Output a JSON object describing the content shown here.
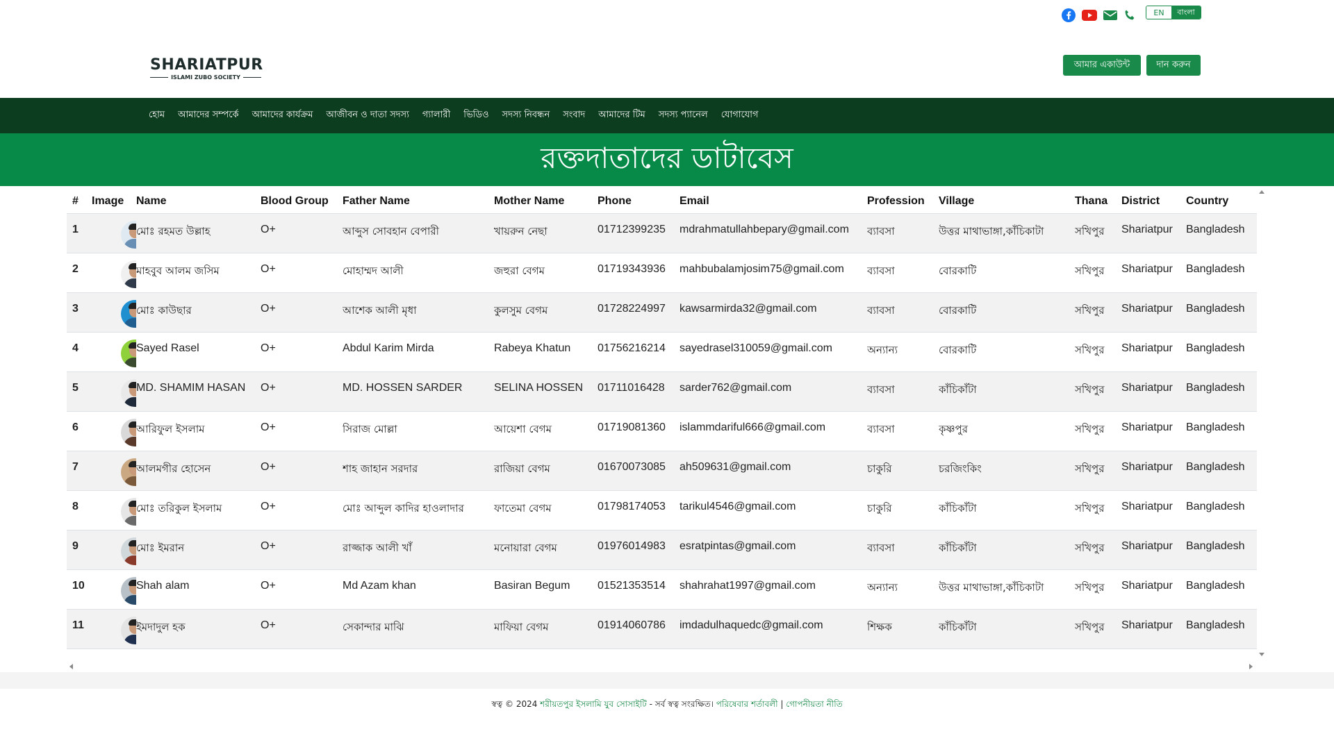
{
  "top_bar": {
    "icons": [
      "facebook-icon",
      "youtube-icon",
      "email-icon",
      "phone-icon"
    ],
    "lang_en": "EN",
    "lang_bn": "বাংলা"
  },
  "logo": {
    "main": "SHARIATPUR",
    "sub": "ISLAMI ZUBO SOCIETY"
  },
  "header": {
    "account_label": "আমার একাউন্ট",
    "donate_label": "দান করুন"
  },
  "nav": {
    "items": [
      "হোম",
      "আমাদের সম্পর্কে",
      "আমাদের কার্যক্রম",
      "আজীবন ও দাতা সদস্য",
      "গ্যালারী",
      "ভিডিও",
      "সদস্য নিবন্ধন",
      "সংবাদ",
      "আমাদের টিম",
      "সদস্য প্যানেল",
      "যোগাযোগ"
    ]
  },
  "hero": {
    "title": "রক্তদাতাদের ডাটাবেস"
  },
  "table": {
    "headers": [
      "#",
      "Image",
      "Name",
      "Blood Group",
      "Father Name",
      "Mother Name",
      "Phone",
      "Email",
      "Profession",
      "Village",
      "Thana",
      "District",
      "Country"
    ],
    "rows": [
      {
        "n": "1",
        "name": "মোঃ রহমত উল্লাহ",
        "blood": "O+",
        "father": "আব্দুস সোবহান বেপারী",
        "mother": "খায়রুন নেছা",
        "phone": "01712399235",
        "email": "mdrahmatullahbepary@gmail.com",
        "profession": "ব্যাবসা",
        "village": "উত্তর মাথাভাঙ্গা,কাঁচিকাটা",
        "thana": "সখিপুর",
        "district": "Shariatpur",
        "country": "Bangladesh"
      },
      {
        "n": "2",
        "name": "মাহবুব আলম জসিম",
        "blood": "O+",
        "father": "মোহাম্মদ আলী",
        "mother": "জহুরা বেগম",
        "phone": "01719343936",
        "email": "mahbubalamjosim75@gmail.com",
        "profession": "ব্যাবসা",
        "village": "বোরকাটি",
        "thana": "সখিপুর",
        "district": "Shariatpur",
        "country": "Bangladesh"
      },
      {
        "n": "3",
        "name": "মোঃ কাউছার",
        "blood": "O+",
        "father": "আশেক আলী মৃধা",
        "mother": "কুলসুম বেগম",
        "phone": "01728224997",
        "email": "kawsarmirda32@gmail.com",
        "profession": "ব্যাবসা",
        "village": "বোরকাটি",
        "thana": "সখিপুর",
        "district": "Shariatpur",
        "country": "Bangladesh"
      },
      {
        "n": "4",
        "name": "Sayed Rasel",
        "blood": "O+",
        "father": "Abdul Karim Mirda",
        "mother": "Rabeya Khatun",
        "phone": "01756216214",
        "email": "sayedrasel310059@gmail.com",
        "profession": "অন্যান্য",
        "village": "বোরকাটি",
        "thana": "সখিপুর",
        "district": "Shariatpur",
        "country": "Bangladesh"
      },
      {
        "n": "5",
        "name": "MD. SHAMIM HASAN",
        "blood": "O+",
        "father": "MD. HOSSEN SARDER",
        "mother": "SELINA HOSSEN",
        "phone": "01711016428",
        "email": "sarder762@gmail.com",
        "profession": "ব্যাবসা",
        "village": "কাঁচিকাঁটা",
        "thana": "সখিপুর",
        "district": "Shariatpur",
        "country": "Bangladesh"
      },
      {
        "n": "6",
        "name": "আরিফুল ইসলাম",
        "blood": "O+",
        "father": "সিরাজ মোল্লা",
        "mother": "আয়েশা বেগম",
        "phone": "01719081360",
        "email": "islammdariful666@gmail.com",
        "profession": "ব্যাবসা",
        "village": "কৃষ্ণপুর",
        "thana": "সখিপুর",
        "district": "Shariatpur",
        "country": "Bangladesh"
      },
      {
        "n": "7",
        "name": "আলমগীর হোসেন",
        "blood": "O+",
        "father": "শাহ জাহান সরদার",
        "mother": "রাজিয়া বেগম",
        "phone": "01670073085",
        "email": "ah509631@gmail.com",
        "profession": "চাকুরি",
        "village": "চরজিংকিং",
        "thana": "সখিপুর",
        "district": "Shariatpur",
        "country": "Bangladesh"
      },
      {
        "n": "8",
        "name": "মোঃ তরিকুল ইসলাম",
        "blood": "O+",
        "father": "মোঃ আব্দুল কাদির হাওলাদার",
        "mother": "ফাতেমা বেগম",
        "phone": "01798174053",
        "email": "tarikul4546@gmail.com",
        "profession": "চাকুরি",
        "village": "কাঁচিকাঁটা",
        "thana": "সখিপুর",
        "district": "Shariatpur",
        "country": "Bangladesh"
      },
      {
        "n": "9",
        "name": "মোঃ ইমরান",
        "blood": "O+",
        "father": "রাজ্জাক আলী খাঁ",
        "mother": "মনোয়ারা বেগম",
        "phone": "01976014983",
        "email": "esratpintas@gmail.com",
        "profession": "ব্যাবসা",
        "village": "কাঁচিকাঁটা",
        "thana": "সখিপুর",
        "district": "Shariatpur",
        "country": "Bangladesh"
      },
      {
        "n": "10",
        "name": "Shah alam",
        "blood": "O+",
        "father": "Md Azam khan",
        "mother": "Basiran Begum",
        "phone": "01521353514",
        "email": "shahrahat1997@gmail.com",
        "profession": "অন্যান্য",
        "village": "উত্তর মাথাভাঙ্গা,কাঁচিকাটা",
        "thana": "সখিপুর",
        "district": "Shariatpur",
        "country": "Bangladesh"
      },
      {
        "n": "11",
        "name": "ইমদাদুল হক",
        "blood": "O+",
        "father": "সেকান্দার মাঝি",
        "mother": "মাফিয়া বেগম",
        "phone": "01914060786",
        "email": "imdadulhaquedc@gmail.com",
        "profession": "শিক্ষক",
        "village": "কাঁচিকাঁটা",
        "thana": "সখিপুর",
        "district": "Shariatpur",
        "country": "Bangladesh"
      }
    ]
  },
  "footer": {
    "prefix": "স্বত্ব © 2024 ",
    "org": "শরীয়তপুর ইসলামি যুব সোসাইটি",
    "rights": " - সর্ব স্বত্ব সংরক্ষিত। ",
    "terms": "পরিষেবার শর্তাবলী",
    "sep": " | ",
    "privacy": "গোপনীয়তা নীতি"
  },
  "colors": {
    "brand_green": "#078a47",
    "nav_dark": "#0d3d1f",
    "button_green": "#1a8a4a"
  }
}
